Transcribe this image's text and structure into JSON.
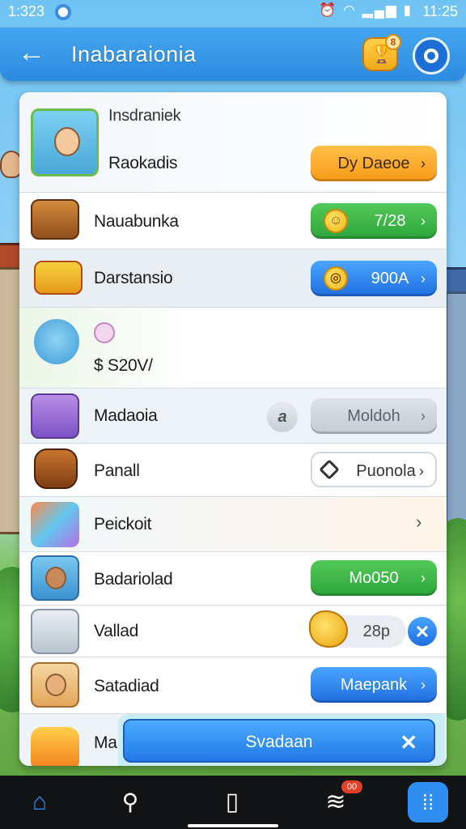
{
  "status_bar": {
    "time_left": "1:323",
    "time_right": "11:25",
    "icons": [
      "alarm-icon",
      "wifi-icon",
      "signal-icon",
      "battery-icon"
    ]
  },
  "header": {
    "title": "Inabaraionia",
    "trophy_badge": "8",
    "accent": "#2d8be0"
  },
  "panel": {
    "section_heading": "Insdraniek",
    "rows": [
      {
        "label": "Raokadis",
        "button": "Dy Daeoe",
        "button_style": "orange",
        "icon": "girl-character-icon"
      },
      {
        "label": "Nauabunka",
        "button": "7/28",
        "button_style": "green",
        "icon": "treasure-chest-icon"
      },
      {
        "label": "Darstansio",
        "button": "900A",
        "button_style": "blue",
        "icon": "gift-box-icon"
      },
      {
        "label": "$ S20V/",
        "icon": "pet-creature-icon"
      },
      {
        "label": "Madaoia",
        "chip": "a",
        "button": "Moldoh",
        "button_style": "grey",
        "icon": "purple-creature-icon"
      },
      {
        "label": "Panall",
        "button": "Puonola",
        "button_style": "white",
        "icon": "backpack-icon"
      },
      {
        "label": "Peickoit",
        "icon": "sweets-icon"
      },
      {
        "label": "Badariolad",
        "button": "Mo050",
        "button_style": "green",
        "icon": "boy-character-icon"
      },
      {
        "label": "Vallad",
        "coin_value": "28p",
        "icon": "crate-icon"
      },
      {
        "label": "Satadiad",
        "button": "Maepank",
        "button_style": "blue",
        "icon": "bear-character-icon"
      },
      {
        "label": "Ma",
        "icon": "dragon-icon"
      }
    ],
    "bottom_button": "Svadaan"
  },
  "nav": {
    "stack_badge": "00",
    "items": [
      "home-icon",
      "search-icon",
      "bag-icon",
      "layers-icon",
      "grid-icon"
    ]
  }
}
